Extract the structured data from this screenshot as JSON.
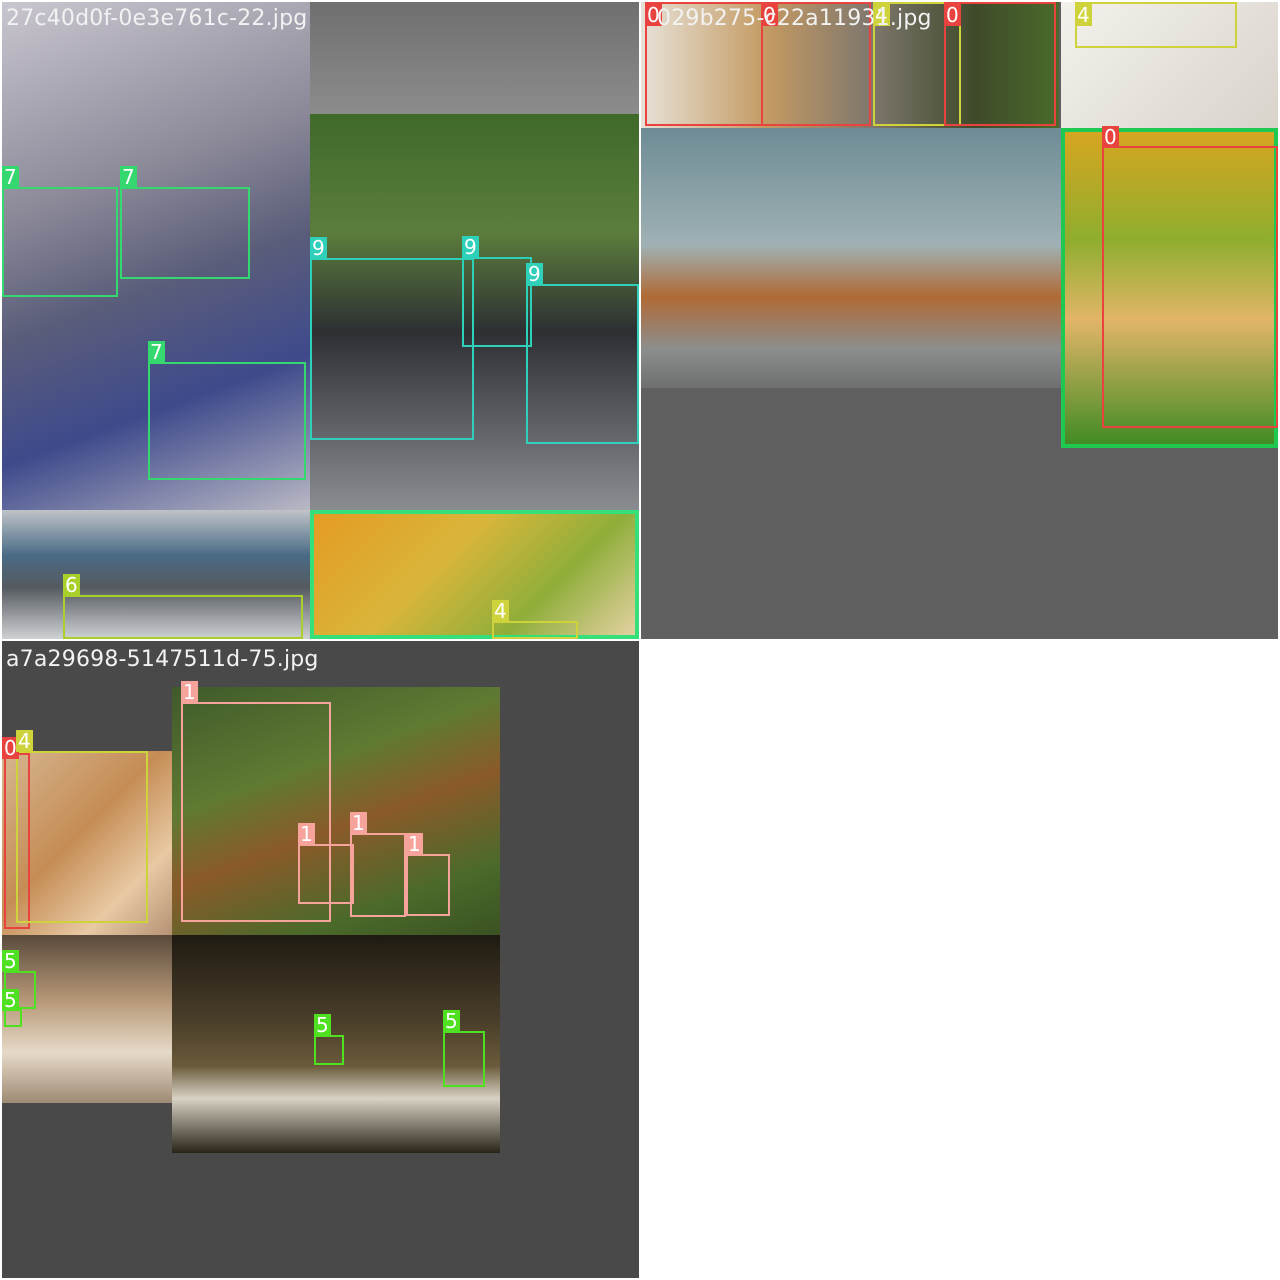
{
  "tiles": [
    {
      "title": "27c40d0f-0e3e761c-22.jpg"
    },
    {
      "title": "029b275-c22a11931.jpg"
    },
    {
      "title": "a7a29698-5147511d-75.jpg"
    }
  ],
  "labels": {
    "zero": "0",
    "one": "1",
    "four": "4",
    "five": "5",
    "six": "6",
    "seven": "7",
    "nine": "9"
  },
  "colors": {
    "class_0": "#e8433f",
    "class_1": "#f6a49b",
    "class_4": "#cfd33b",
    "class_5": "#4ee021",
    "class_6": "#a9cf2a",
    "class_7": "#35d86f",
    "class_9": "#2ed0b9"
  }
}
